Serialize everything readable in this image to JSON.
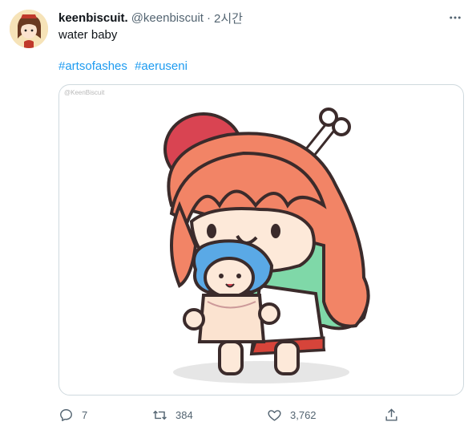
{
  "tweet": {
    "display_name": "keenbiscuit.",
    "handle": "@keenbiscuit",
    "separator": "·",
    "time": "2시간",
    "text": "water baby",
    "hashtags": [
      "#artsofashes",
      "#aeruseni"
    ]
  },
  "media": {
    "watermark": "@KeenBiscuit"
  },
  "actions": {
    "reply_count": "7",
    "retweet_count": "384",
    "like_count": "3,762"
  },
  "colors": {
    "link": "#1d9bf0",
    "secondary_text": "#536471",
    "border": "#cfd9de"
  }
}
